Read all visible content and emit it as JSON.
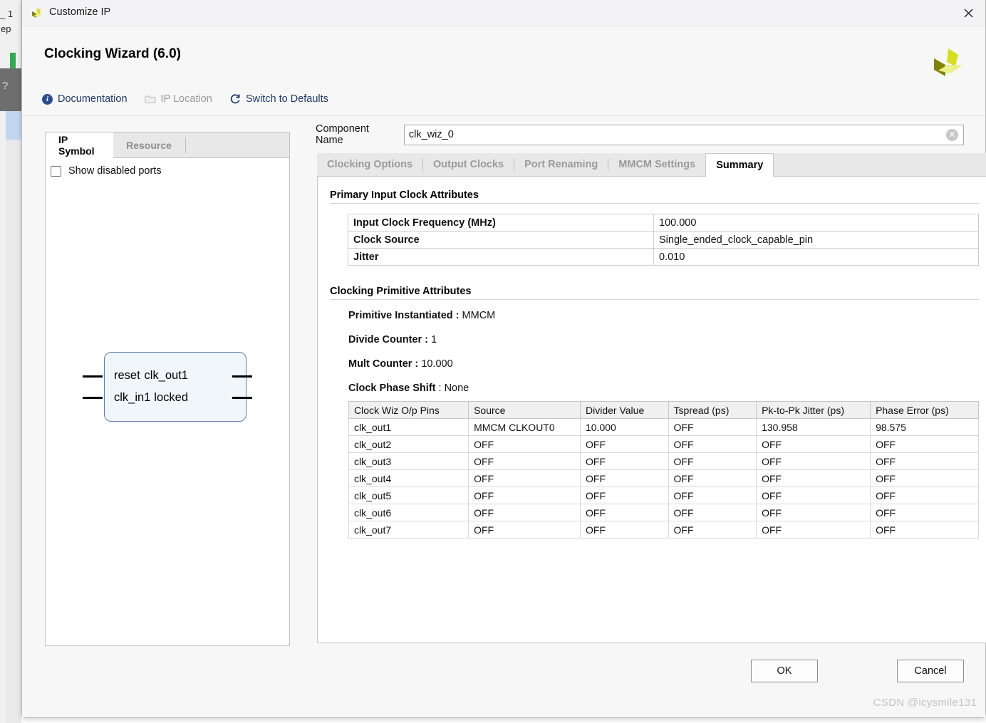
{
  "window": {
    "title": "Customize IP",
    "logo_icon": "xilinx-logo-icon",
    "close_icon": "close-icon"
  },
  "header": {
    "wizard_title": "Clocking Wizard (6.0)",
    "brand_logo_icon": "xilinx-brand-logo-icon",
    "toolbar": [
      {
        "label": "Documentation",
        "icon": "info-icon",
        "disabled": false
      },
      {
        "label": "IP Location",
        "icon": "folder-icon",
        "disabled": true
      },
      {
        "label": "Switch to Defaults",
        "icon": "refresh-icon",
        "disabled": false
      }
    ]
  },
  "left_panel": {
    "tabs": [
      {
        "label": "IP Symbol",
        "active": true
      },
      {
        "label": "Resource",
        "active": false
      }
    ],
    "show_disabled_ports": {
      "label": "Show disabled ports",
      "checked": false
    },
    "symbol": {
      "inputs": [
        "reset",
        "clk_in1"
      ],
      "outputs": [
        "clk_out1",
        "locked"
      ]
    }
  },
  "component": {
    "label": "Component Name",
    "value": "clk_wiz_0",
    "placeholder": "",
    "clear_icon": "clear-circle-icon"
  },
  "tabs": [
    {
      "label": "Clocking Options",
      "active": false
    },
    {
      "label": "Output Clocks",
      "active": false
    },
    {
      "label": "Port Renaming",
      "active": false
    },
    {
      "label": "MMCM Settings",
      "active": false
    },
    {
      "label": "Summary",
      "active": true
    }
  ],
  "summary": {
    "primary_input_clock": {
      "title": "Primary Input Clock Attributes",
      "rows": [
        {
          "key": "Input Clock Frequency (MHz)",
          "value": "100.000"
        },
        {
          "key": "Clock Source",
          "value": "Single_ended_clock_capable_pin"
        },
        {
          "key": "Jitter",
          "value": "0.010"
        }
      ]
    },
    "clocking_primitive": {
      "title": "Clocking Primitive Attributes",
      "kv": [
        {
          "key": "Primitive Instantiated :",
          "value": "MMCM"
        },
        {
          "key": "Divide Counter :",
          "value": "1"
        },
        {
          "key": "Mult Counter :",
          "value": "10.000"
        },
        {
          "key": "Clock Phase Shift",
          "value": ": None"
        }
      ],
      "table": {
        "headers": [
          "Clock Wiz O/p Pins",
          "Source",
          "Divider Value",
          "Tspread (ps)",
          "Pk-to-Pk Jitter (ps)",
          "Phase Error (ps)"
        ],
        "rows": [
          [
            "clk_out1",
            "MMCM CLKOUT0",
            "10.000",
            "OFF",
            "130.958",
            "98.575"
          ],
          [
            "clk_out2",
            "OFF",
            "OFF",
            "OFF",
            "OFF",
            "OFF"
          ],
          [
            "clk_out3",
            "OFF",
            "OFF",
            "OFF",
            "OFF",
            "OFF"
          ],
          [
            "clk_out4",
            "OFF",
            "OFF",
            "OFF",
            "OFF",
            "OFF"
          ],
          [
            "clk_out5",
            "OFF",
            "OFF",
            "OFF",
            "OFF",
            "OFF"
          ],
          [
            "clk_out6",
            "OFF",
            "OFF",
            "OFF",
            "OFF",
            "OFF"
          ],
          [
            "clk_out7",
            "OFF",
            "OFF",
            "OFF",
            "OFF",
            "OFF"
          ]
        ]
      }
    }
  },
  "footer": {
    "ok_label": "OK",
    "cancel_label": "Cancel",
    "watermark": "CSDN @icysmile131"
  },
  "background": {
    "fragment_top": "_ 1",
    "fragment_side": "ep",
    "question_mark": "?"
  },
  "colors": {
    "brand_yellow": "#d6de23",
    "brand_olive": "#828207",
    "link_navy": "#1f3864",
    "tab_inactive": "#9a9a9a",
    "panel_bg": "#f7f7f7"
  }
}
